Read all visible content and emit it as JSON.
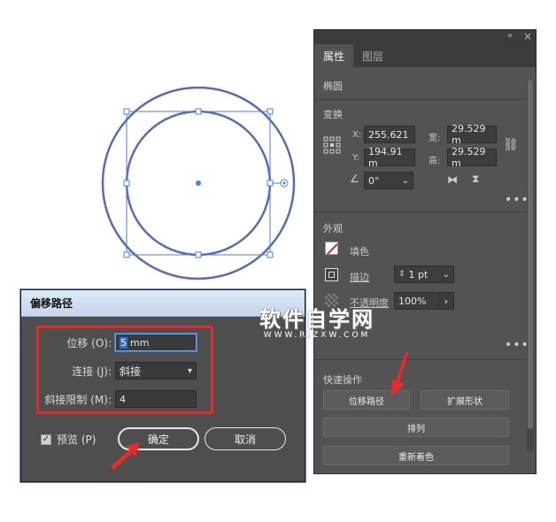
{
  "colors": {
    "shape_stroke": "#5a6bb5",
    "selection": "#4a7de0",
    "highlight_box": "#e12a2a",
    "arrow": "#e82a2a",
    "dialog_bg": "#4e4e4e",
    "panel_bg": "#535353"
  },
  "dialog": {
    "title": "偏移路径",
    "offset_label": "位移 (O):",
    "offset_value_selected": "5",
    "offset_unit": "mm",
    "joins_label": "连接 (J):",
    "joins_value": "斜接",
    "miter_label": "斜接限制 (M):",
    "miter_value": "4",
    "preview_label": "预览 (P)",
    "preview_checked": "✓",
    "ok_label": "确定",
    "cancel_label": "取消"
  },
  "panel": {
    "collapse_icon": "«",
    "close_icon": "×",
    "tabs": [
      {
        "label": "属性"
      },
      {
        "label": "图层"
      }
    ],
    "object_type": "椭圆",
    "transform": {
      "title": "变换",
      "x_label": "X:",
      "x_value": "255.621",
      "y_label": "Y:",
      "y_value": "194.91 m",
      "w_label": "宽:",
      "w_value": "29.529 m",
      "h_label": "高:",
      "h_value": "29.529 m",
      "angle_value": "0°"
    },
    "appearance": {
      "title": "外观",
      "fill_label": "填色",
      "stroke_label": "描边",
      "stroke_value": "1 pt",
      "opacity_label": "不透明度",
      "opacity_value": "100%"
    },
    "quick_actions": {
      "title": "快速操作",
      "offset_path": "位移路径",
      "expand_shape": "扩展形状",
      "arrange": "排列",
      "recolor": "重新着色"
    },
    "more": "•••"
  },
  "watermark": {
    "big": "软件自学网",
    "small": "WWW.RJZXW.COM"
  }
}
